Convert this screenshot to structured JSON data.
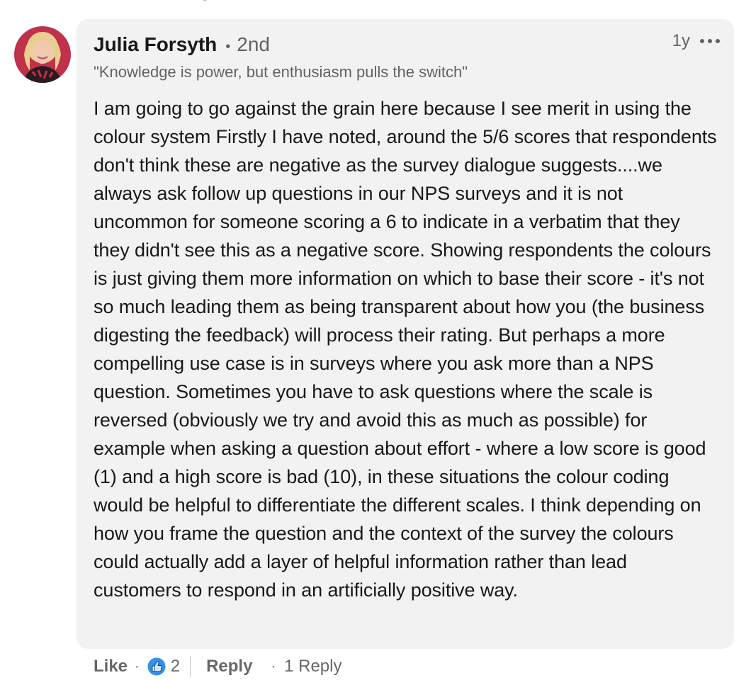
{
  "comment": {
    "author": {
      "name": "Julia Forsyth",
      "separator": "•",
      "degree": "2nd",
      "headline": "\"Knowledge is power, but enthusiasm pulls the switch\"",
      "avatar_icon": "profile-photo"
    },
    "timestamp": "1y",
    "more_icon": "ellipsis-icon",
    "body": "I am going to go against the grain here because I see merit in using the colour system Firstly I have noted, around the 5/6 scores that respondents don't think these are negative as the survey dialogue suggests....we always ask follow up questions in our NPS surveys and it is not uncommon for someone scoring a 6 to indicate in a verbatim that they they didn't see this as a negative score. Showing respondents the colours is just giving them more information on which to base their score - it's not so much leading them as being transparent about how you (the business digesting the feedback) will process their rating. But perhaps a more compelling use case is in surveys where you ask more than a NPS question. Sometimes you have to ask questions where the scale is reversed (obviously we try and avoid this as much as possible) for example when asking a question about effort - where a low score is good (1) and a high score is bad (10), in these situations the colour coding would be helpful to differentiate the different scales. I think depending on how you frame the question and the context of the survey the colours could actually add a layer of helpful information rather than lead customers to respond in an artificially positive way."
  },
  "actions": {
    "like_label": "Like",
    "dot": "·",
    "reaction_icon": "like-reaction-icon",
    "reaction_count": "2",
    "reply_label": "Reply",
    "replies_label": "1 Reply"
  },
  "colors": {
    "bubble_bg": "#f2f2f2",
    "text_primary": "rgba(0,0,0,0.9)",
    "text_secondary": "rgba(0,0,0,0.6)",
    "like_blue": "#378fe9"
  }
}
